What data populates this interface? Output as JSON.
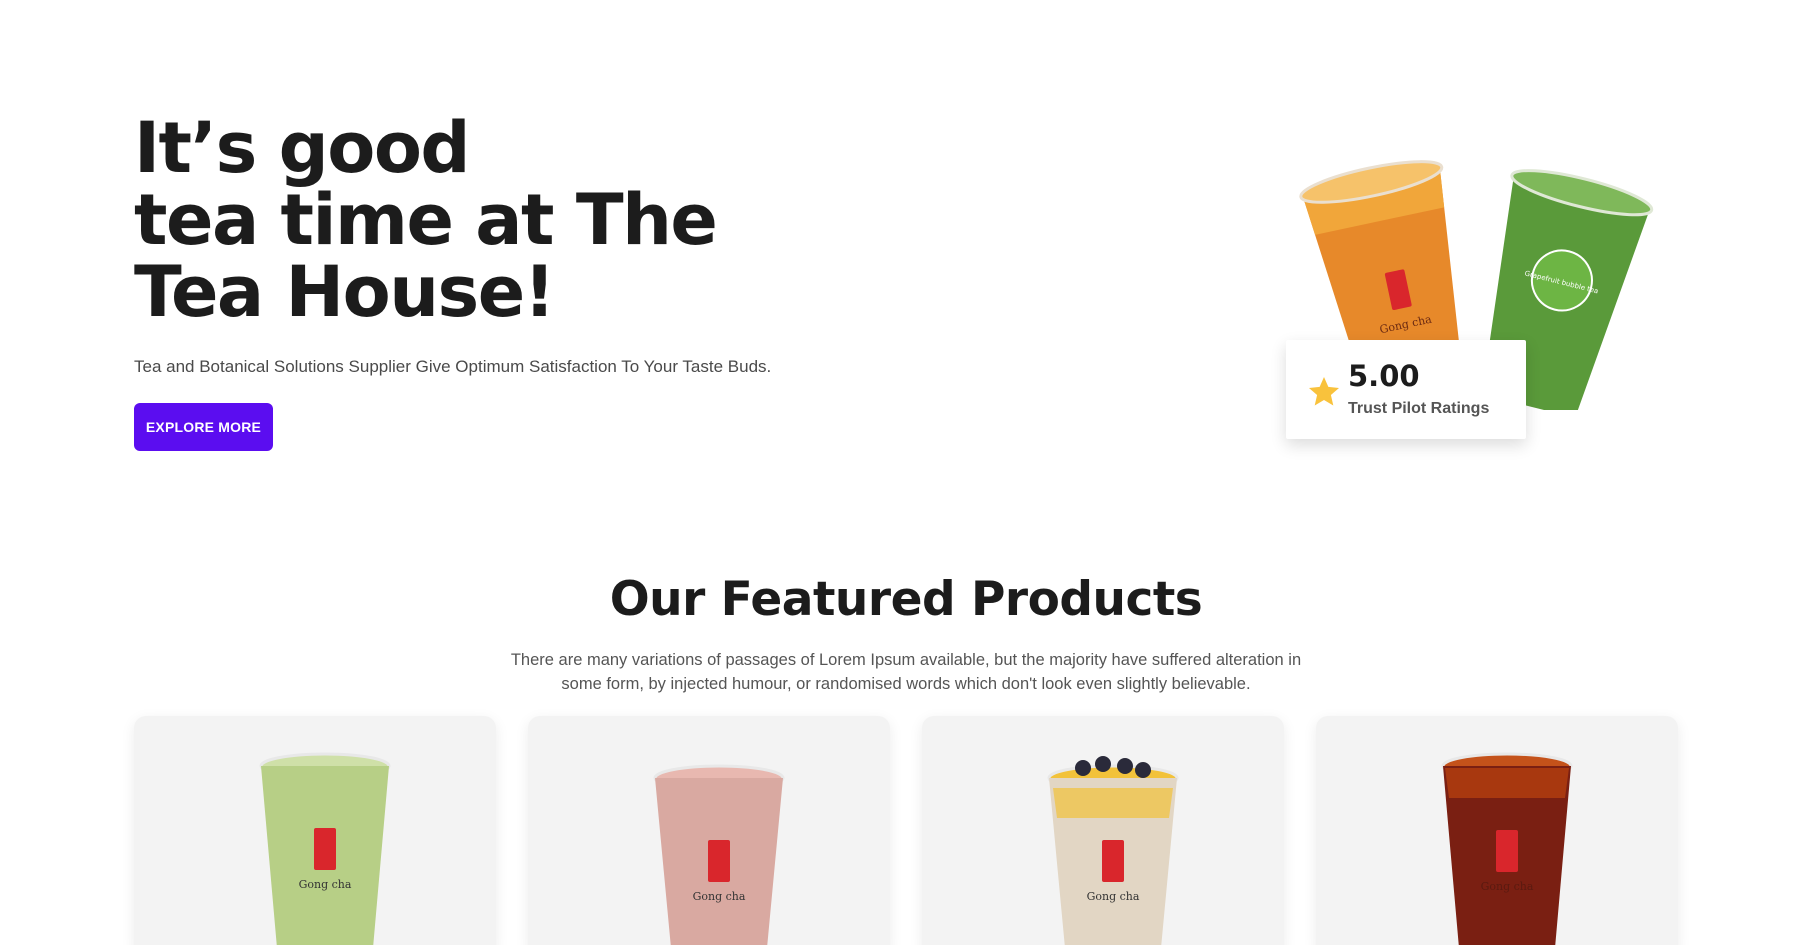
{
  "hero": {
    "title_line1": "It’s good",
    "title_line2": "tea time at The",
    "title_line3": "Tea House!",
    "subtitle": "Tea and Botanical Solutions Supplier Give Optimum Satisfaction To Your Taste Buds.",
    "cta_label": "EXPLORE MORE",
    "accent_color": "#5b0df0",
    "cup_brand": "Gong cha",
    "cup_sticker": "Grapefruit bubble tea"
  },
  "rating": {
    "value": "5.00",
    "label": "Trust Pilot Ratings",
    "icon": "star-icon",
    "star_color": "#f9c23c"
  },
  "featured": {
    "title": "Our Featured Products",
    "description": "There are many variations of passages of Lorem Ipsum available, but the majority have suffered alteration in some form, by injected humour, or randomised words which don't look even slightly believable.",
    "products": [
      {
        "brand": "Gong cha",
        "drink_color": "#b7cf86"
      },
      {
        "brand": "Gong cha",
        "drink_color": "#d9a9a1"
      },
      {
        "brand": "Gong cha",
        "drink_color": "#e2d6c4"
      },
      {
        "brand": "Gong cha",
        "drink_color": "#7a1f12"
      }
    ]
  }
}
